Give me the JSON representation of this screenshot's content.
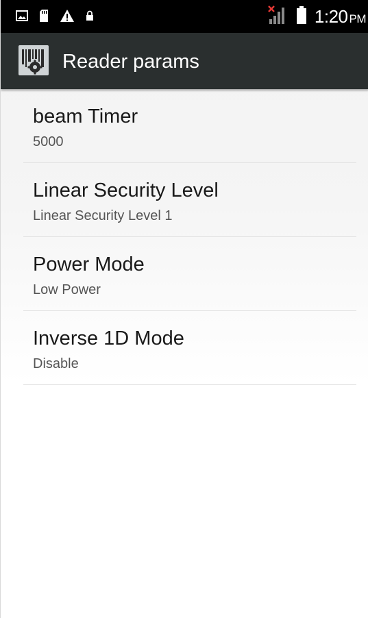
{
  "status_bar": {
    "time": "1:20",
    "ampm": "PM",
    "icons": [
      "image-notification-icon",
      "sd-card-icon",
      "warning-icon",
      "lock-icon",
      "no-signal-icon",
      "battery-icon"
    ]
  },
  "action_bar": {
    "title": "Reader params",
    "icon": "barcode-settings-icon"
  },
  "preferences": [
    {
      "title": "beam Timer",
      "summary": "5000"
    },
    {
      "title": "Linear Security Level",
      "summary": "Linear Security Level 1"
    },
    {
      "title": "Power Mode",
      "summary": "Low Power"
    },
    {
      "title": "Inverse 1D Mode",
      "summary": "Disable"
    }
  ],
  "colors": {
    "status_bar": "#000000",
    "action_bar": "#2a2f2f",
    "title_text": "#1a1a1a",
    "summary_text": "#555555",
    "divider": "#e2e2e2",
    "no_signal_x": "#e53935"
  }
}
